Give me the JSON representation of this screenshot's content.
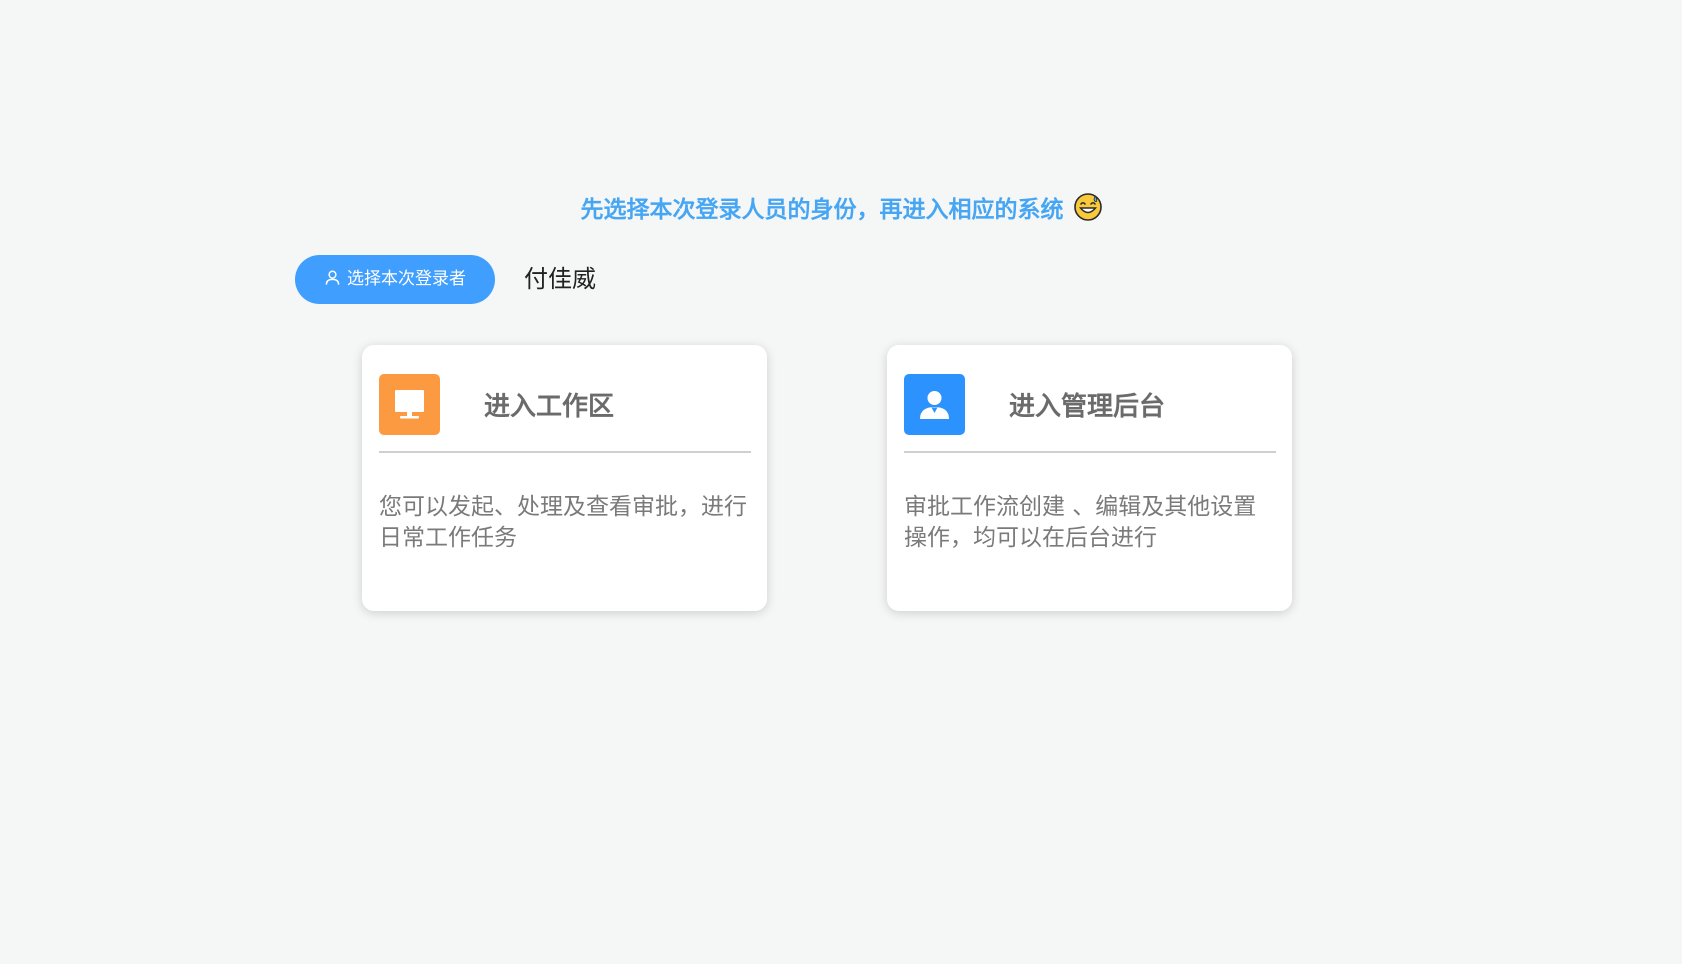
{
  "header": {
    "title": "先选择本次登录人员的身份，再进入相应的系统",
    "emoji_icon": "grinning-sweat-emoji-icon"
  },
  "login_selector": {
    "button_label": "选择本次登录者",
    "button_icon": "user-icon",
    "selected_user": "付佳威"
  },
  "cards": {
    "workspace": {
      "icon": "monitor-icon",
      "icon_color": "#fc9a41",
      "title": "进入工作区",
      "description": "您可以发起、处理及查看审批，进行日常工作任务"
    },
    "admin": {
      "icon": "user-icon",
      "icon_color": "#2c92fd",
      "title": "进入管理后台",
      "description": "审批工作流创建 、编辑及其他设置操作，均可以在后台进行"
    }
  },
  "colors": {
    "accent": "#409eff",
    "headline": "#46a6f4",
    "background": "#f5f6f6"
  }
}
